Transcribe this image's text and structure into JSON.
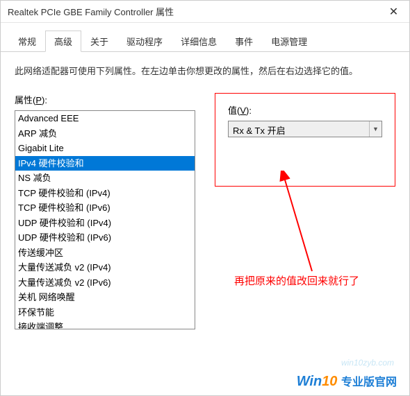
{
  "titlebar": {
    "title": "Realtek PCIe GBE Family Controller 属性"
  },
  "tabs": [
    {
      "label": "常规"
    },
    {
      "label": "高级"
    },
    {
      "label": "关于"
    },
    {
      "label": "驱动程序"
    },
    {
      "label": "详细信息"
    },
    {
      "label": "事件"
    },
    {
      "label": "电源管理"
    }
  ],
  "description": "此网络适配器可使用下列属性。在左边单击你想更改的属性，然后在右边选择它的值。",
  "prop_label_pre": "属性(",
  "prop_label_key": "P",
  "prop_label_post": "):",
  "value_label_pre": "值(",
  "value_label_key": "V",
  "value_label_post": "):",
  "properties": [
    "Advanced EEE",
    "ARP 减负",
    "Gigabit Lite",
    "IPv4 硬件校验和",
    "NS 减负",
    "TCP 硬件校验和 (IPv4)",
    "TCP 硬件校验和 (IPv6)",
    "UDP 硬件校验和 (IPv4)",
    "UDP 硬件校验和 (IPv6)",
    "传送缓冲区",
    "大量传送减负 v2 (IPv4)",
    "大量传送减负 v2 (IPv6)",
    "关机 网络唤醒",
    "环保节能",
    "接收端调整"
  ],
  "selected_index": 3,
  "value_selected": "Rx & Tx 开启",
  "annotation": "再把原来的值改回来就行了",
  "watermark_url": "win10zyb.com",
  "watermark_brand_a": "Win",
  "watermark_brand_b": "10",
  "watermark_brand_cn": "专业版官网"
}
